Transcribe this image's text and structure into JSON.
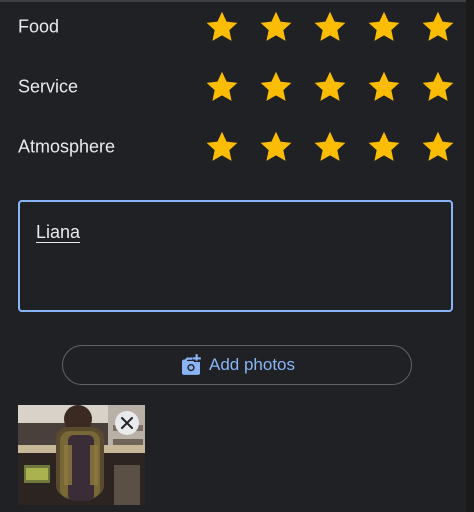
{
  "ratings": [
    {
      "label": "Food",
      "value": 5,
      "max": 5
    },
    {
      "label": "Service",
      "value": 5,
      "max": 5
    },
    {
      "label": "Atmosphere",
      "value": 5,
      "max": 5
    }
  ],
  "review": {
    "value": "Liana"
  },
  "add_photos": {
    "label": "Add photos",
    "icon": "add-photo-icon"
  },
  "photos": [
    {
      "name": "uploaded-photo",
      "remove_icon": "close-icon"
    }
  ],
  "colors": {
    "background": "#202124",
    "star": "#fbbc04",
    "accent": "#8ab4f8",
    "text": "#e8eaed",
    "outline": "#5f6368"
  }
}
